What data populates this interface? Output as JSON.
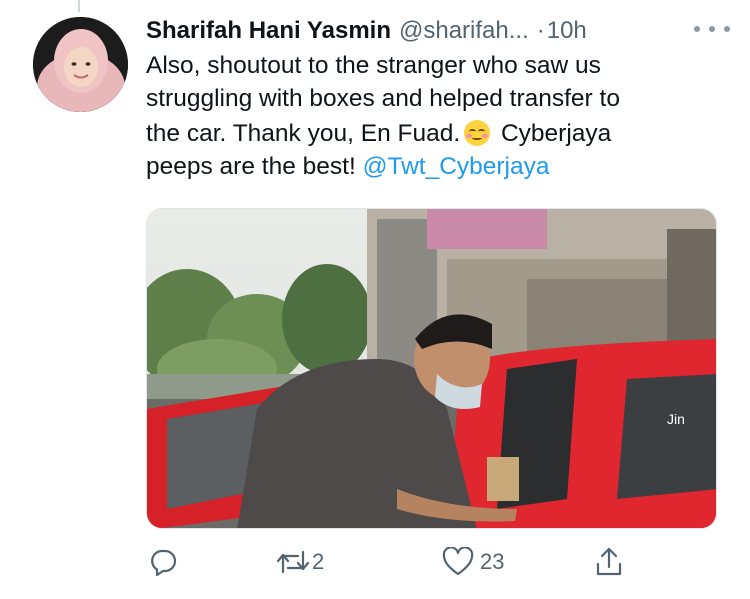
{
  "tweet": {
    "author_name": "Sharifah Hani Yasmin",
    "handle": "@sharifah...",
    "separator": "·",
    "time": "10h",
    "text_lines": {
      "l1": "Also, shoutout to the stranger who saw us",
      "l2": "struggling with boxes and helped transfer to",
      "l3a": "the car. Thank you, En Fuad.",
      "l3b": "Cyberjaya",
      "l4a": "peeps are the best!",
      "l4_mention": "@Twt_Cyberjaya"
    },
    "emoji": "smiling-face-with-blush"
  },
  "actions": {
    "reply_count": "",
    "retweet_count": "2",
    "like_count": "23"
  },
  "colors": {
    "mention": "#1d9bf0",
    "secondary_text": "#536471",
    "car_red": "#e0262e"
  },
  "icons": [
    "reply-icon",
    "retweet-icon",
    "like-icon",
    "share-icon",
    "more-icon"
  ]
}
